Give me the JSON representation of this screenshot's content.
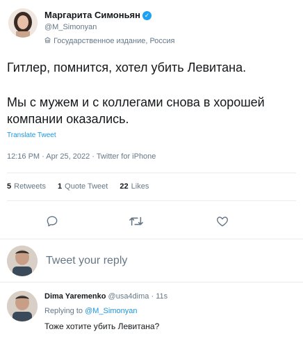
{
  "tweet": {
    "author_name": "Маргарита Симоньян",
    "author_handle": "@M_Simonyan",
    "affiliation": "Государственное издание, Россия",
    "text_line1": "Гитлер, помнится, хотел убить Левитана.",
    "text_line2": "Мы с мужем и с коллегами снова в хорошей",
    "text_line3": "компании оказались.",
    "translate_label": "Translate Tweet",
    "timestamp": "12:16 PM · Apr 25, 2022 · Twitter for iPhone",
    "stats": {
      "retweets_count": "5",
      "retweets_label": "Retweets",
      "quotes_count": "1",
      "quotes_label": "Quote Tweet",
      "likes_count": "22",
      "likes_label": "Likes"
    },
    "actions": [
      "reply-icon",
      "retweet-icon",
      "like-icon"
    ]
  },
  "reply_box": {
    "placeholder": "Tweet your reply"
  },
  "reply": {
    "author_name": "Dima Yaremenko",
    "author_handle": "@usa4dima",
    "time": "· 11s",
    "replying_prefix": "Replying to",
    "replying_to": "@M_Simonyan",
    "text": "Тоже хотите убить Левитана?"
  },
  "colors": {
    "accent": "#1da1f2",
    "link": "#1b95e0",
    "muted": "#657786",
    "divider": "#e6ecf0"
  }
}
